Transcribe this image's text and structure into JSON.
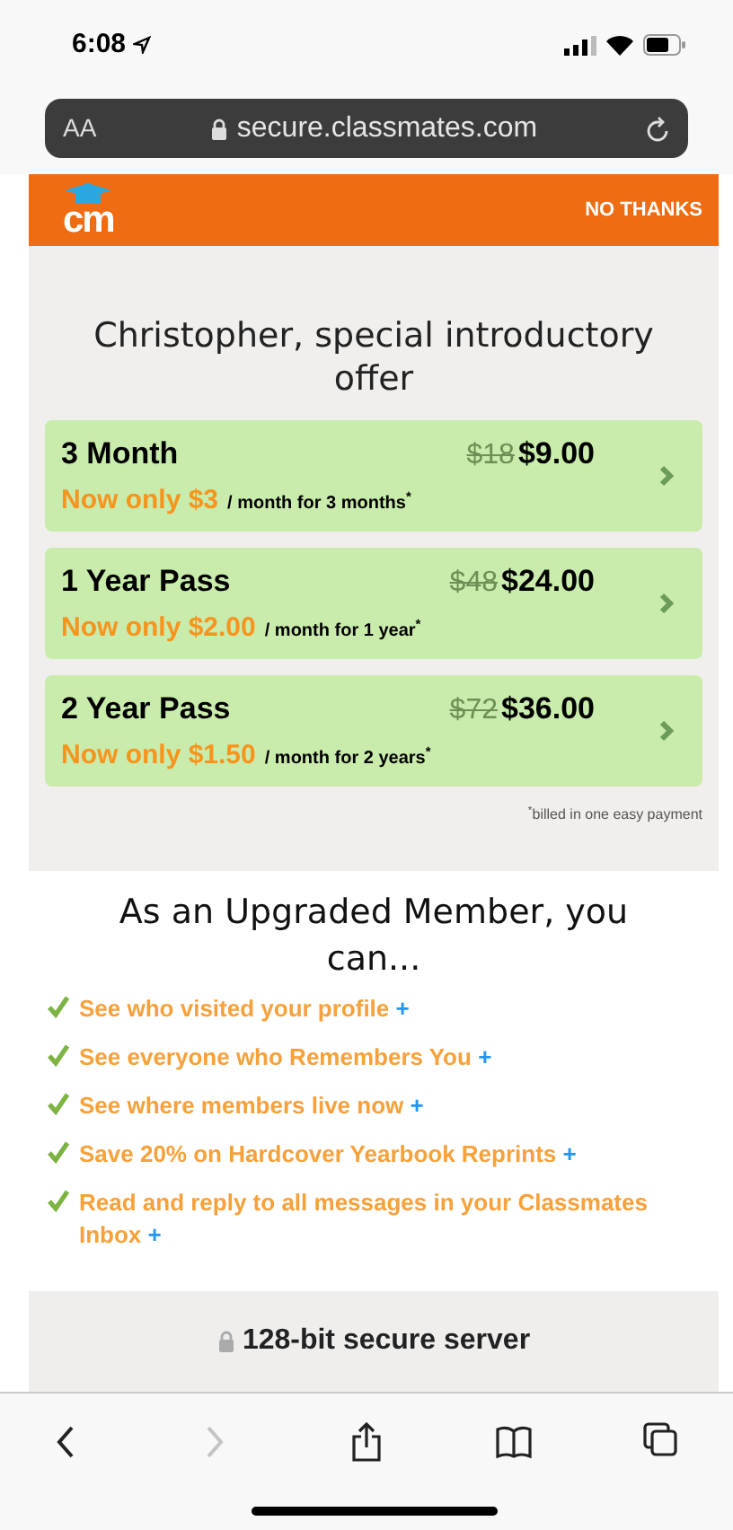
{
  "status_bar": {
    "time": "6:08"
  },
  "address_bar": {
    "text_size": "AA",
    "url": "secure.classmates.com"
  },
  "header": {
    "logo": "cm",
    "dismiss": "NO THANKS"
  },
  "offer": {
    "title": "Christopher, special introductory offer",
    "plans": [
      {
        "name": "3 Month",
        "old_price": "$18",
        "price": "$9.00",
        "promo": "Now only $3",
        "terms": "/ month for 3 months$^{*}$"
      },
      {
        "name": "1 Year Pass",
        "old_price": "$48",
        "price": "$24.00",
        "promo": "Now only $2.00",
        "terms": "/ month for 1 year$^{*}$"
      },
      {
        "name": "2 Year Pass",
        "old_price": "$72",
        "price": "$36.00",
        "promo": "Now only $1.50",
        "terms": "/ month for 2 years$^{*}$"
      }
    ],
    "footnote": "$^{*}$billed in one easy payment"
  },
  "benefits": {
    "title": "As an Upgraded Member, you can...",
    "items": [
      {
        "text": "See who visited your profile",
        "more": "+"
      },
      {
        "text": "See everyone who Remembers You",
        "more": "+"
      },
      {
        "text": "See where members live now",
        "more": "+"
      },
      {
        "text": "Save 20% on Hardcover Yearbook Reprints",
        "more": "+"
      },
      {
        "text": "Read and reply to all messages in your Classmates Inbox",
        "more": "+"
      }
    ]
  },
  "security": {
    "label": "128-bit secure server"
  },
  "toolbar": [
    {
      "kind": "back",
      "disabled": false
    },
    {
      "kind": "forward",
      "disabled": true
    },
    {
      "kind": "share",
      "disabled": false
    },
    {
      "kind": "bookmarks",
      "disabled": false
    },
    {
      "kind": "tabs",
      "disabled": false
    }
  ]
}
